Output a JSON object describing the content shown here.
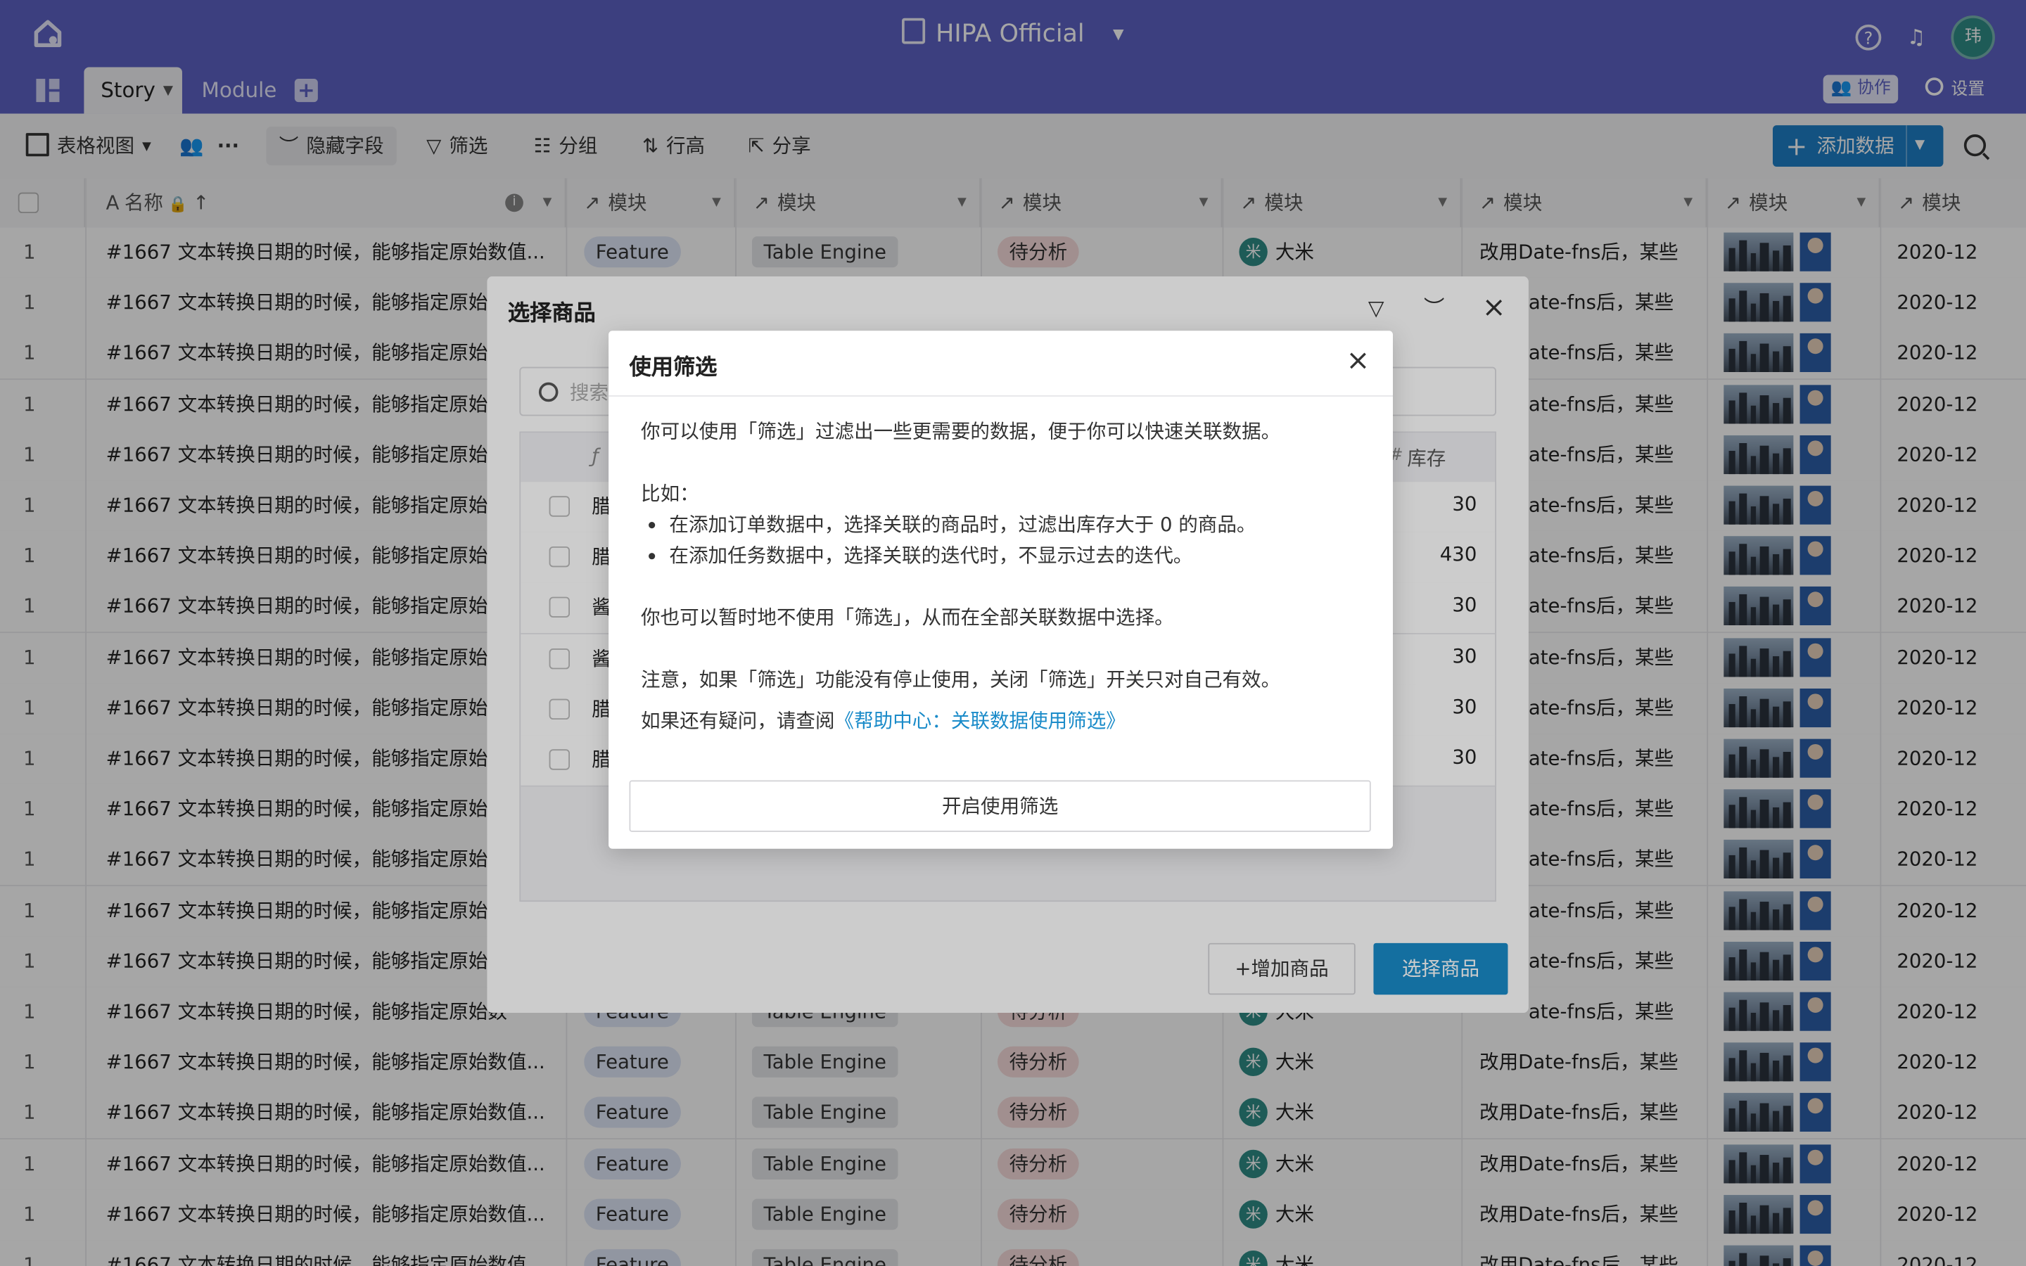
{
  "app": {
    "workspace_title": "HIPA Official",
    "avatar_initial": "玮",
    "collab_label": "协作",
    "settings_label": "设置",
    "help_symbol": "?"
  },
  "tabs": [
    {
      "label": "Story",
      "active": true
    },
    {
      "label": "Module",
      "active": false
    }
  ],
  "toolbar": {
    "view_label": "表格视图",
    "hide_fields_label": "隐藏字段",
    "filter_label": "筛选",
    "group_label": "分组",
    "row_height_label": "行高",
    "share_label": "分享",
    "add_data_label": "添加数据"
  },
  "table": {
    "columns": [
      {
        "label": "名称"
      },
      {
        "label": "模块"
      },
      {
        "label": "模块"
      },
      {
        "label": "模块"
      },
      {
        "label": "模块"
      },
      {
        "label": "模块"
      },
      {
        "label": "模块"
      },
      {
        "label": "模块"
      }
    ],
    "row": {
      "index": "1",
      "name_full": "#1667 文本转换日期的时候，能够指定原始数值...",
      "name_short": "#1667 文本转换日期的时候，能够指定原始数",
      "type": "Feature",
      "engine": "Table Engine",
      "status": "待分析",
      "person_icon": "米",
      "person": "大米",
      "note": "改用Date-fns后，某些",
      "note_clipped": "ate-fns后，某些",
      "date": "2020-12"
    }
  },
  "select_modal": {
    "title": "选择商品",
    "search_placeholder": "搜索",
    "col_stock": "库存",
    "rows": [
      {
        "name": "腊",
        "stock": "30"
      },
      {
        "name": "腊",
        "stock": "430"
      },
      {
        "name": "酱",
        "stock": "30"
      },
      {
        "name": "酱",
        "stock": "30"
      },
      {
        "name": "腊",
        "stock": "30"
      },
      {
        "name": "腊",
        "stock": "30"
      }
    ],
    "add_button": "+增加商品",
    "confirm_button": "选择商品"
  },
  "filter_dialog": {
    "title": "使用筛选",
    "intro": "你可以使用「筛选」过滤出一些更需要的数据，便于你可以快速关联数据。",
    "example_heading": "比如：",
    "examples": [
      "在添加订单数据中，选择关联的商品时，过滤出库存大于 0 的商品。",
      "在添加任务数据中，选择关联的迭代时，不显示过去的迭代。"
    ],
    "temp_disable": "你也可以暂时地不使用「筛选」，从而在全部关联数据中选择。",
    "note": "注意，如果「筛选」功能没有停止使用，关闭「筛选」开关只对自己有效。",
    "help_prefix": "如果还有疑问，请查阅",
    "help_link": "《帮助中心：关联数据使用筛选》",
    "enable_button": "开启使用筛选"
  },
  "colors": {
    "header_bg": "#5c61c4",
    "primary": "#1e7fc7",
    "link": "#1a8bc9"
  }
}
